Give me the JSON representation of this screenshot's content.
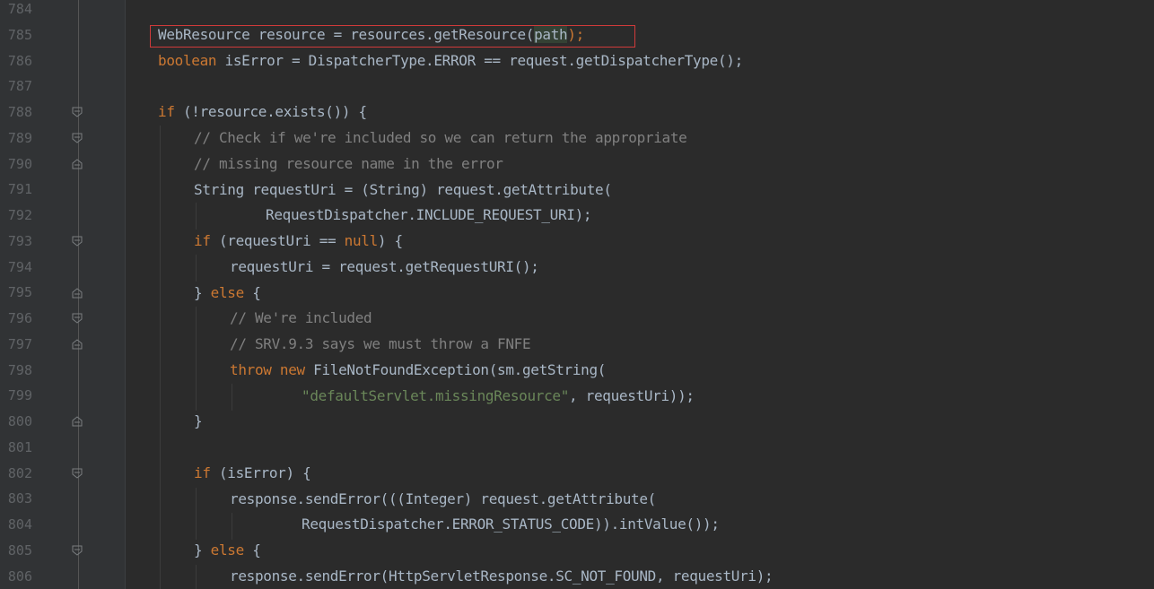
{
  "editor": {
    "lines": [
      {
        "number": "784",
        "text": ""
      },
      {
        "number": "785",
        "text": "WebResource resource = resources.getResource(path);"
      },
      {
        "number": "786",
        "text": "boolean isError = DispatcherType.ERROR == request.getDispatcherType();"
      },
      {
        "number": "787",
        "text": ""
      },
      {
        "number": "788",
        "text": "if (!resource.exists()) {"
      },
      {
        "number": "789",
        "text": "// Check if we're included so we can return the appropriate"
      },
      {
        "number": "790",
        "text": "// missing resource name in the error"
      },
      {
        "number": "791",
        "text": "String requestUri = (String) request.getAttribute("
      },
      {
        "number": "792",
        "text": "RequestDispatcher.INCLUDE_REQUEST_URI);"
      },
      {
        "number": "793",
        "text": "if (requestUri == null) {"
      },
      {
        "number": "794",
        "text": "requestUri = request.getRequestURI();"
      },
      {
        "number": "795",
        "text": "} else {"
      },
      {
        "number": "796",
        "text": "// We're included"
      },
      {
        "number": "797",
        "text": "// SRV.9.3 says we must throw a FNFE"
      },
      {
        "number": "798",
        "text": "throw new FileNotFoundException(sm.getString("
      },
      {
        "number": "799",
        "text": "\"defaultServlet.missingResource\", requestUri));"
      },
      {
        "number": "800",
        "text": "}"
      },
      {
        "number": "801",
        "text": ""
      },
      {
        "number": "802",
        "text": "if (isError) {"
      },
      {
        "number": "803",
        "text": "response.sendError(((Integer) request.getAttribute("
      },
      {
        "number": "804",
        "text": "RequestDispatcher.ERROR_STATUS_CODE)).intValue());"
      },
      {
        "number": "805",
        "text": "} else {"
      },
      {
        "number": "806",
        "text": "response.sendError(HttpServletResponse.SC_NOT_FOUND, requestUri);"
      }
    ],
    "tokens": {
      "l785_a": "WebResource resource = resources.getResource(",
      "l785_path": "path",
      "l785_b": ");",
      "l786_kw": "boolean",
      "l786_rest": " isError = DispatcherType.ERROR == request.getDispatcherType();",
      "l788_kw": "if",
      "l788_rest": " (!resource.exists()) {",
      "l789": "// Check if we're included so we can return the appropriate",
      "l790": "// missing resource name in the error",
      "l791": "String requestUri = (String) request.getAttribute(",
      "l792": "RequestDispatcher.INCLUDE_REQUEST_URI);",
      "l793_kw": "if",
      "l793_a": " (requestUri == ",
      "l793_null": "null",
      "l793_b": ") {",
      "l794": "requestUri = request.getRequestURI();",
      "l795_a": "} ",
      "l795_kw": "else",
      "l795_b": " {",
      "l796": "// We're included",
      "l797": "// SRV.9.3 says we must throw a FNFE",
      "l798_throw": "throw",
      "l798_sp": " ",
      "l798_new": "new",
      "l798_rest": " FileNotFoundException(sm.getString(",
      "l799_str": "\"defaultServlet.missingResource\"",
      "l799_rest": ", requestUri));",
      "l800": "}",
      "l802_kw": "if",
      "l802_rest": " (isError) {",
      "l803": "response.sendError(((Integer) request.getAttribute(",
      "l804": "RequestDispatcher.ERROR_STATUS_CODE)).intValue());",
      "l805_a": "} ",
      "l805_kw": "else",
      "l805_b": " {",
      "l806": "response.sendError(HttpServletResponse.SC_NOT_FOUND, requestUri);"
    }
  },
  "colors": {
    "background": "#2b2b2b",
    "gutter": "#313335",
    "keyword": "#cc7832",
    "comment": "#808080",
    "string": "#6a8759",
    "text": "#a9b7c6",
    "highlight_border": "#d03a3a"
  },
  "icons": [
    "fold-open-icon",
    "fold-close-icon"
  ]
}
